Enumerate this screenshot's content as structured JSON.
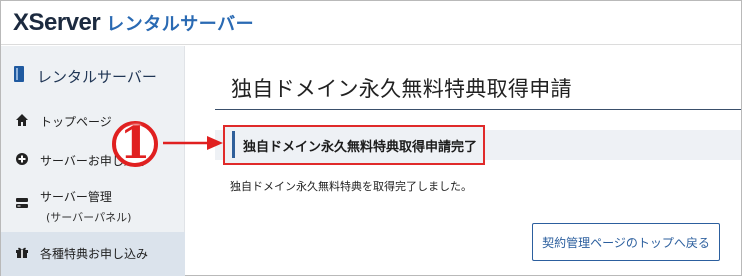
{
  "header": {
    "brand": "XServer",
    "subtitle": "レンタルサーバー"
  },
  "sidebar": {
    "title": "レンタルサーバー",
    "items": [
      {
        "label": "トップページ",
        "icon": "home-icon"
      },
      {
        "label": "サーバーお申し込み",
        "icon": "plus-circle-icon"
      },
      {
        "label": "サーバー管理",
        "sub": "(サーバーパネル)",
        "icon": "server-icon"
      },
      {
        "label": "各種特典お申し込み",
        "icon": "gift-icon",
        "active": true
      }
    ]
  },
  "main": {
    "page_title": "独自ドメイン永久無料特典取得申請",
    "result_heading": "独自ドメイン永久無料特典取得申請完了",
    "message": "独自ドメイン永久無料特典を取得完了しました。",
    "back_button": "契約管理ページのトップへ戻る"
  },
  "annotation": {
    "marker": "1"
  },
  "colors": {
    "accent": "#2c5f9e",
    "annotation": "#e02a2a",
    "sidebar_bg": "#eef1f4"
  }
}
